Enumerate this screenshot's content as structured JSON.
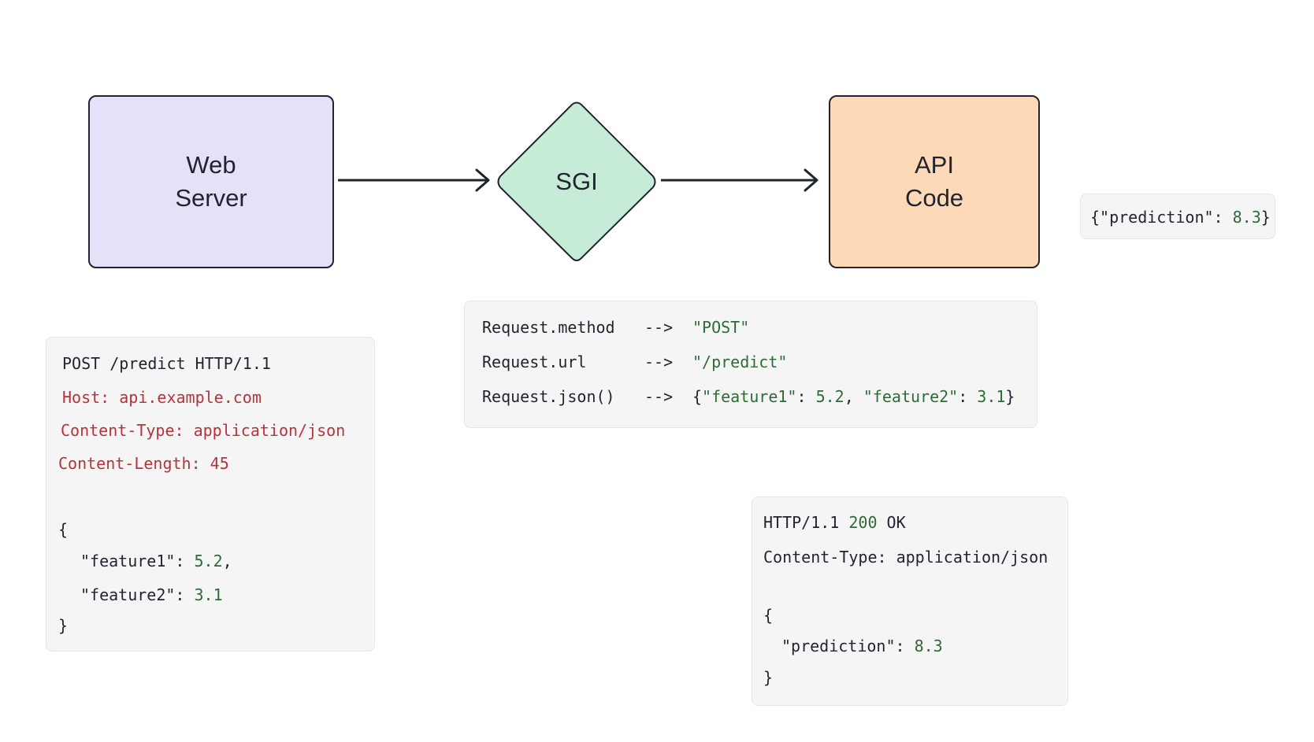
{
  "nodes": {
    "web_server": {
      "label": "Web\nServer",
      "fill": "#e6e0f8"
    },
    "sgi": {
      "label": "SGI",
      "fill": "#c6ecd7"
    },
    "api_code": {
      "label": "API\nCode",
      "fill": "#fdd9b8"
    }
  },
  "edges": [
    {
      "from": "web_server",
      "to": "sgi"
    },
    {
      "from": "sgi",
      "to": "api_code"
    }
  ],
  "api_output": {
    "open": "{\"prediction\": ",
    "value": "8.3",
    "close": "}"
  },
  "request": {
    "request_line": "POST /predict HTTP/1.1",
    "host": "Host: api.example.com",
    "content_type": "Content-Type: application/json",
    "content_length_key": "Content-Length: ",
    "content_length_value": "45",
    "open_brace": "{",
    "f1_key": "\"feature1\": ",
    "f1_value": "5.2",
    "f1_comma": ",",
    "f2_key": "\"feature2\": ",
    "f2_value": "3.1",
    "close_brace": "}"
  },
  "mapping": {
    "rows": [
      {
        "left": "Request.method",
        "arrow": "-->",
        "value": "\"POST\""
      },
      {
        "left": "Request.url",
        "arrow": "-->",
        "value": "\"/predict\""
      },
      {
        "left": "Request.json()",
        "arrow": "-->"
      }
    ],
    "json": {
      "open": "{",
      "k1": "\"feature1\"",
      "sep1": ": ",
      "v1": "5.2",
      "comma": ", ",
      "k2": "\"feature2\"",
      "sep2": ": ",
      "v2": "3.1",
      "close": "}"
    }
  },
  "response": {
    "status_prefix": "HTTP/1.1 ",
    "status_code": "200",
    "status_text": " OK",
    "content_type": "Content-Type: application/json",
    "open_brace": "{",
    "pred_key": "\"prediction\": ",
    "pred_value": "8.3",
    "close_brace": "}"
  },
  "colors": {
    "stroke": "#1f2430",
    "key_red": "#b5333a",
    "value_green": "#2e6b36",
    "code_bg": "#f5f5f5"
  }
}
